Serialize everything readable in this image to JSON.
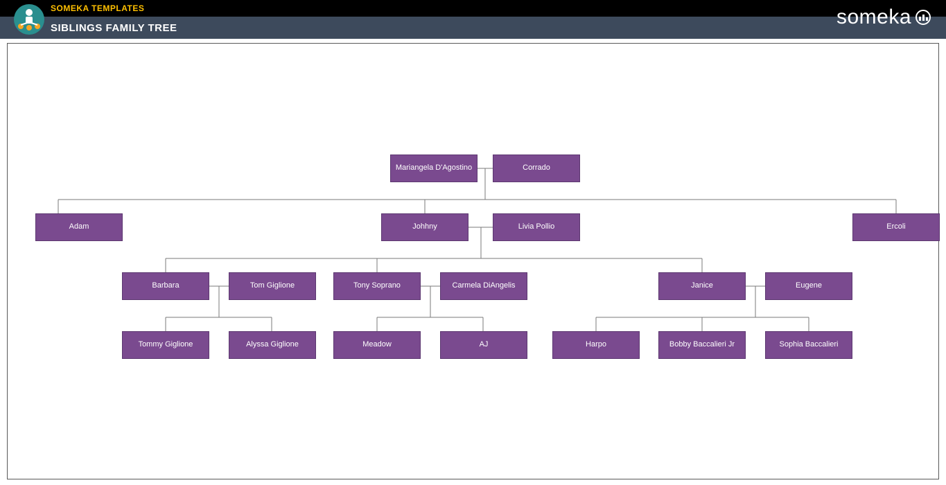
{
  "header": {
    "top_label": "SOMEKA TEMPLATES",
    "sub_label": "SIBLINGS FAMILY TREE",
    "brand": "someka"
  },
  "colors": {
    "node_bg": "#7a4a8f",
    "header_accent": "#ffc000",
    "header_sub_bg": "#3d4a5c"
  },
  "tree": {
    "gen1": {
      "mariangela": "Mariangela D'Agostino",
      "corrado": "Corrado"
    },
    "gen2": {
      "adam": "Adam",
      "johhny": "Johhny",
      "livia": "Livia Pollio",
      "ercoli": "Ercoli"
    },
    "gen3": {
      "barbara": "Barbara",
      "tom_giglione": "Tom Giglione",
      "tony": "Tony Soprano",
      "carmela": "Carmela DiAngelis",
      "janice": "Janice",
      "eugene": "Eugene"
    },
    "gen4": {
      "tommy": "Tommy Giglione",
      "alyssa": "Alyssa Giglione",
      "meadow": "Meadow",
      "aj": "AJ",
      "harpo": "Harpo",
      "bobby": "Bobby Baccalieri Jr",
      "sophia": "Sophia Baccalieri"
    }
  }
}
